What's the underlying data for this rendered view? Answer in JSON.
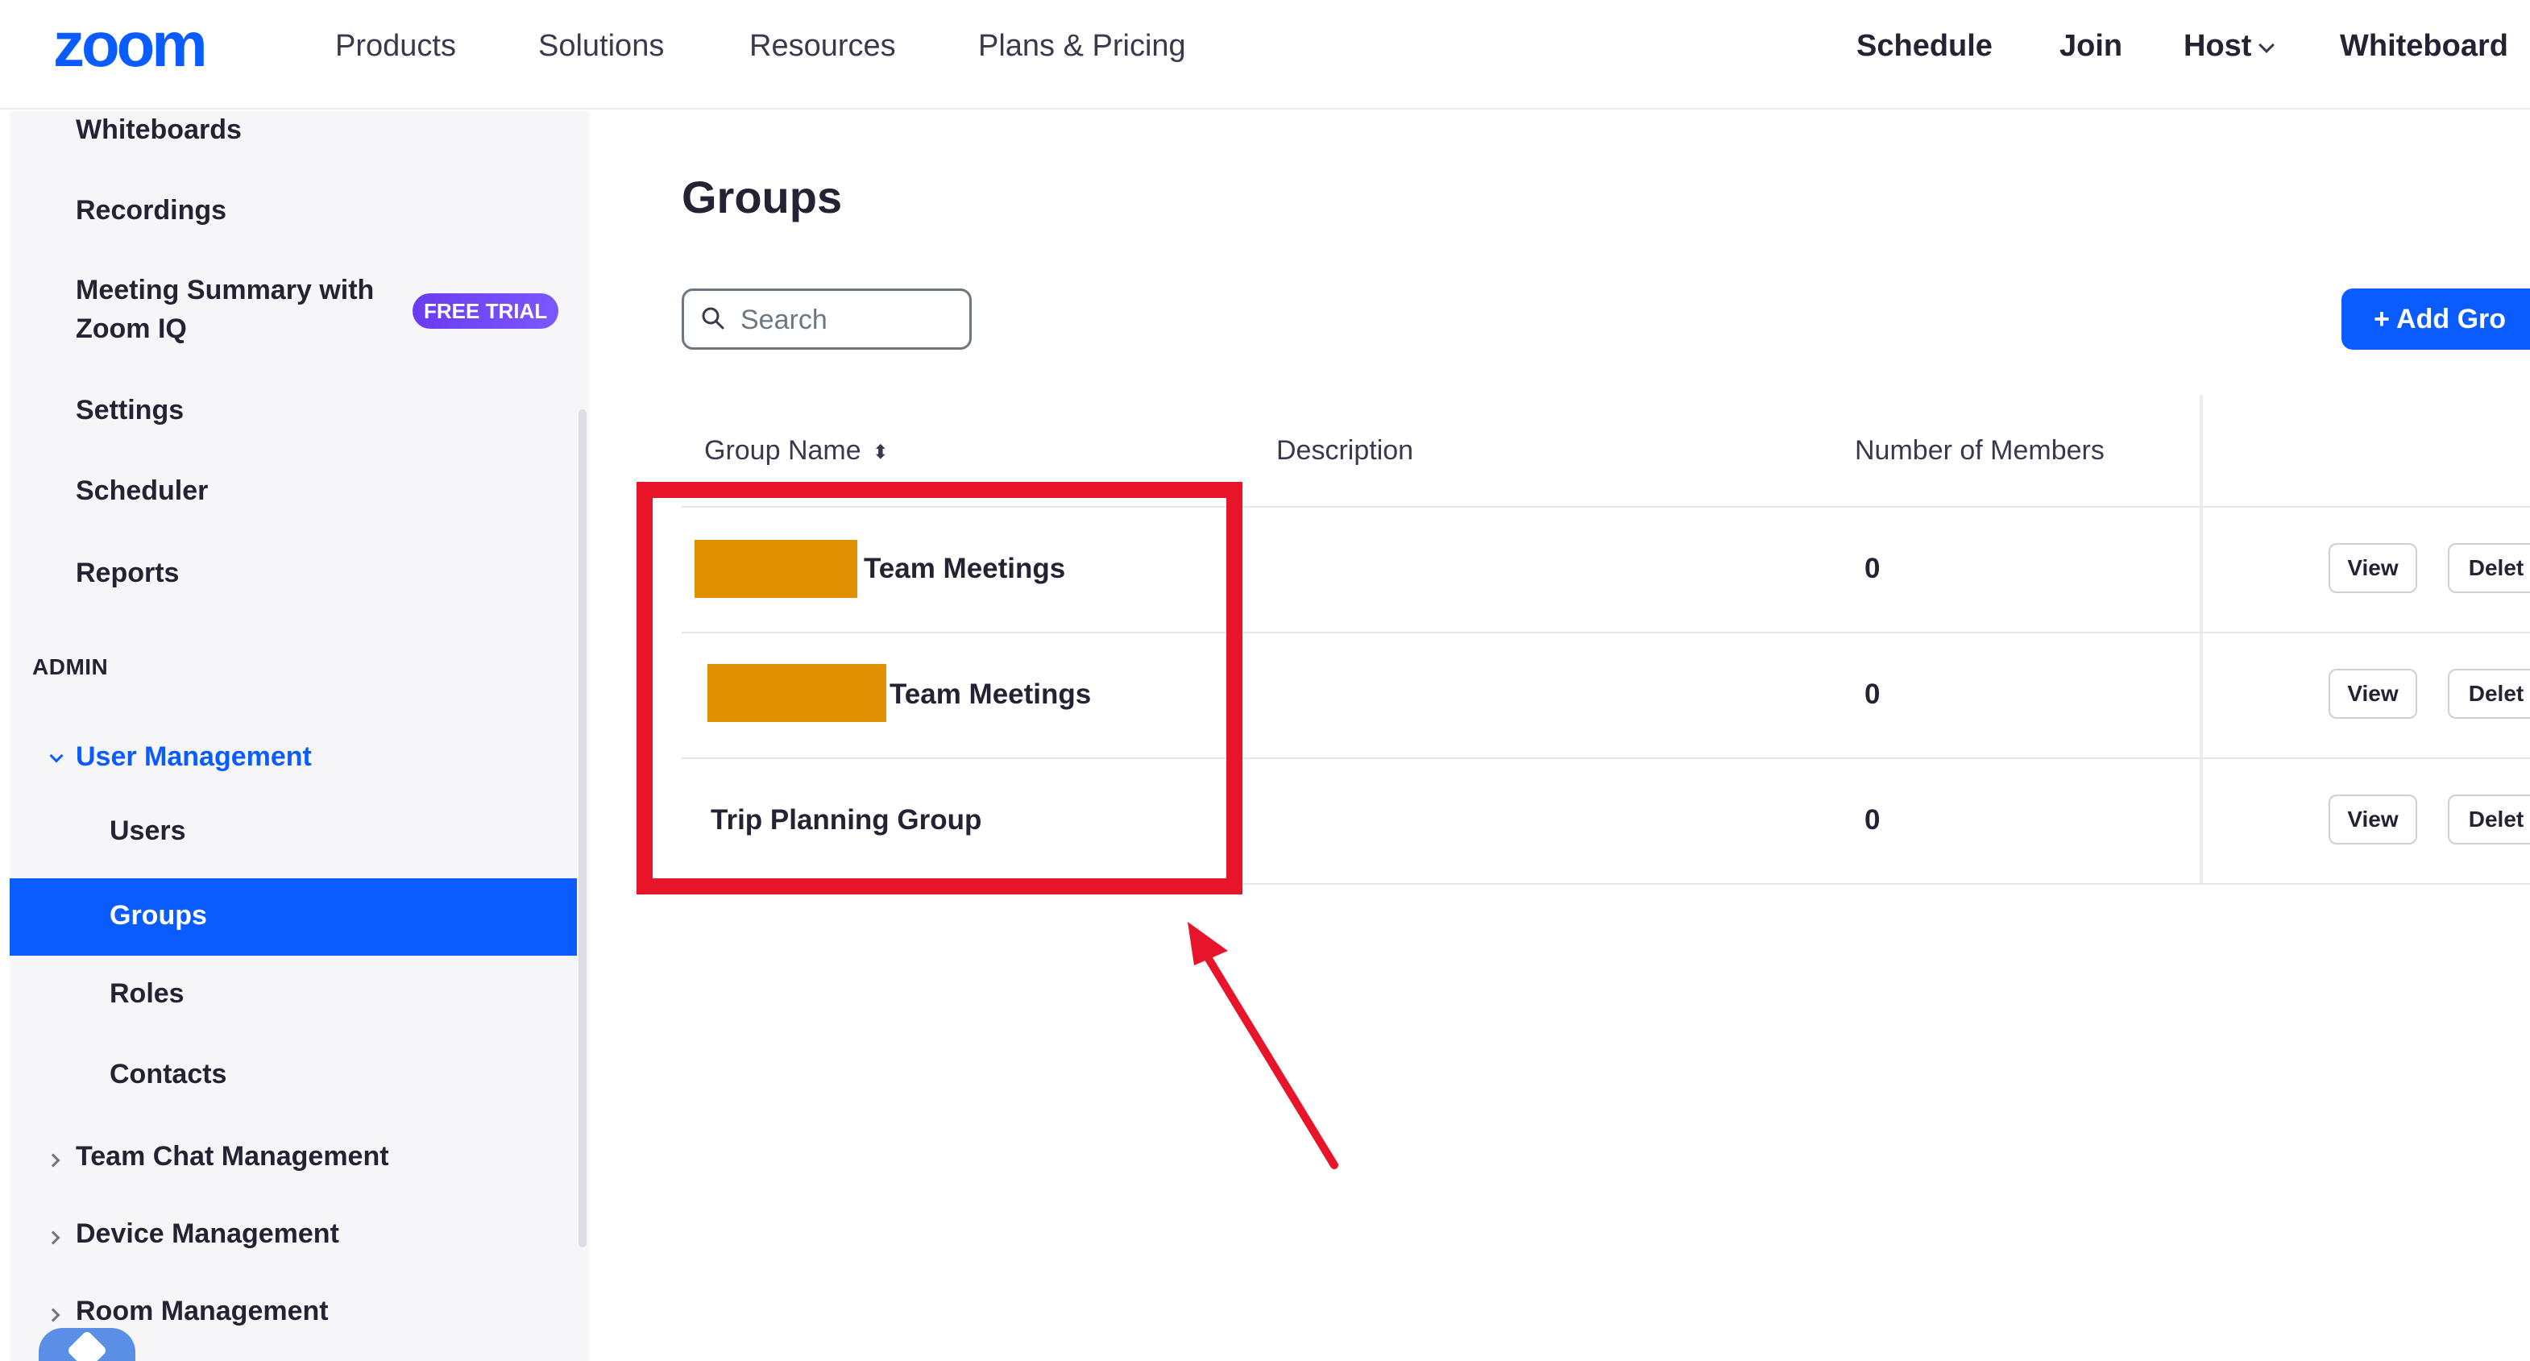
{
  "topnav": {
    "logo": "zoom",
    "left_links": [
      "Products",
      "Solutions",
      "Resources",
      "Plans & Pricing"
    ],
    "right_links": {
      "schedule": "Schedule",
      "join": "Join",
      "host": "Host",
      "whiteboard": "Whiteboard"
    }
  },
  "sidebar": {
    "items_top": [
      "Whiteboards",
      "Recordings"
    ],
    "summary": {
      "label_line1": "Meeting Summary with",
      "label_line2": "Zoom IQ",
      "badge": "FREE TRIAL"
    },
    "items_mid": [
      "Settings",
      "Scheduler",
      "Reports"
    ],
    "admin_section": "ADMIN",
    "user_management": "User Management",
    "sub_items": {
      "users": "Users",
      "groups": "Groups",
      "roles": "Roles",
      "contacts": "Contacts"
    },
    "collapsed_groups": [
      "Team Chat Management",
      "Device Management",
      "Room Management"
    ]
  },
  "main": {
    "title": "Groups",
    "search": {
      "placeholder": "Search"
    },
    "add_button": "+ Add Gro",
    "table": {
      "headers": {
        "group_name": "Group Name",
        "description": "Description",
        "members": "Number of Members"
      },
      "rows": [
        {
          "name": "Team Meetings",
          "description": "",
          "members": "0",
          "view": "View",
          "delete": "Delet"
        },
        {
          "name": "Team Meetings",
          "description": "",
          "members": "0",
          "view": "View",
          "delete": "Delet"
        },
        {
          "name": "Trip Planning Group",
          "description": "",
          "members": "0",
          "view": "View",
          "delete": "Delet"
        }
      ]
    }
  },
  "colors": {
    "brand_blue": "#0b5cff",
    "highlight_red": "#e8152a",
    "redaction_orange": "#e09000",
    "badge_purple": "#6a3cf0"
  }
}
